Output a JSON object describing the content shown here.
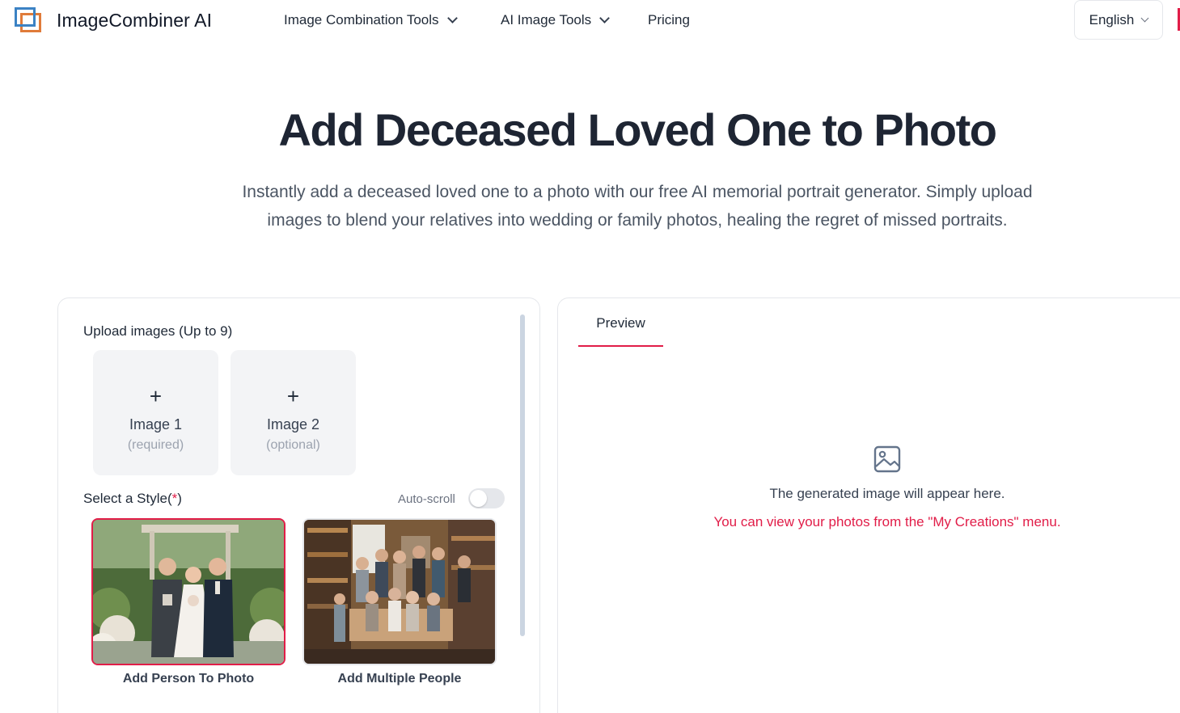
{
  "header": {
    "brand": "ImageCombiner AI",
    "nav": [
      {
        "label": "Image Combination Tools",
        "has_dropdown": true
      },
      {
        "label": "AI Image Tools",
        "has_dropdown": true
      },
      {
        "label": "Pricing",
        "has_dropdown": false
      }
    ],
    "language": "English"
  },
  "hero": {
    "title": "Add Deceased Loved One to Photo",
    "subtitle_line1": "Instantly add a deceased loved one to a photo with our free AI memorial portrait generator. Simply upload",
    "subtitle_line2": "images to blend your relatives into wedding or family photos, healing the regret of missed portraits."
  },
  "upload": {
    "label": "Upload images (Up to 9)",
    "slots": [
      {
        "plus": "+",
        "name": "Image 1",
        "note": "(required)"
      },
      {
        "plus": "+",
        "name": "Image 2",
        "note": "(optional)"
      }
    ]
  },
  "style_select": {
    "label": "Select a Style(",
    "required_mark": "*",
    "label_close": ")",
    "autoscroll_label": "Auto-scroll",
    "autoscroll_on": false,
    "styles": [
      {
        "caption": "Add Person To Photo",
        "selected": true,
        "icon": "wedding-photo-thumbnail"
      },
      {
        "caption": "Add Multiple People",
        "selected": false,
        "icon": "family-photo-thumbnail"
      }
    ]
  },
  "preview": {
    "tab_label": "Preview",
    "empty_text": "The generated image will appear here.",
    "hint_text": "You can view your photos from the \"My Creations\" menu."
  },
  "colors": {
    "accent": "#e11d48",
    "title": "#1e2533",
    "logo_blue": "#3b82c4",
    "logo_orange": "#e07b3a"
  }
}
